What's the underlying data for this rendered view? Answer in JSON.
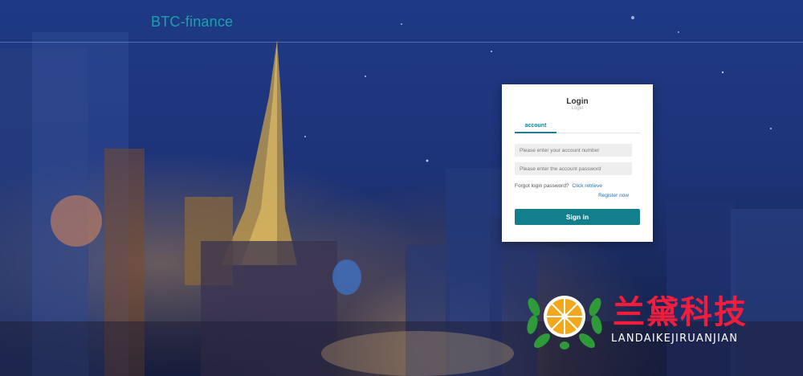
{
  "header": {
    "brand": "BTC-finance"
  },
  "login": {
    "title": "Login",
    "subtitle": "Login",
    "tabs": [
      {
        "label": "account",
        "active": true
      }
    ],
    "account_placeholder": "Please enter your account number",
    "password_placeholder": "Please enter the account password",
    "forgot_label": "Forgot login password?",
    "forgot_link": "Click retrieve",
    "register_link": "Register now",
    "submit_label": "Sign in"
  },
  "watermark": {
    "chinese": "兰黛科技",
    "english": "LANDAIKEJIRUANJIAN"
  },
  "colors": {
    "accent": "#137f8d",
    "brand_text": "#1f9fae",
    "link": "#2a6fb0",
    "watermark_red": "#f01e3c"
  }
}
